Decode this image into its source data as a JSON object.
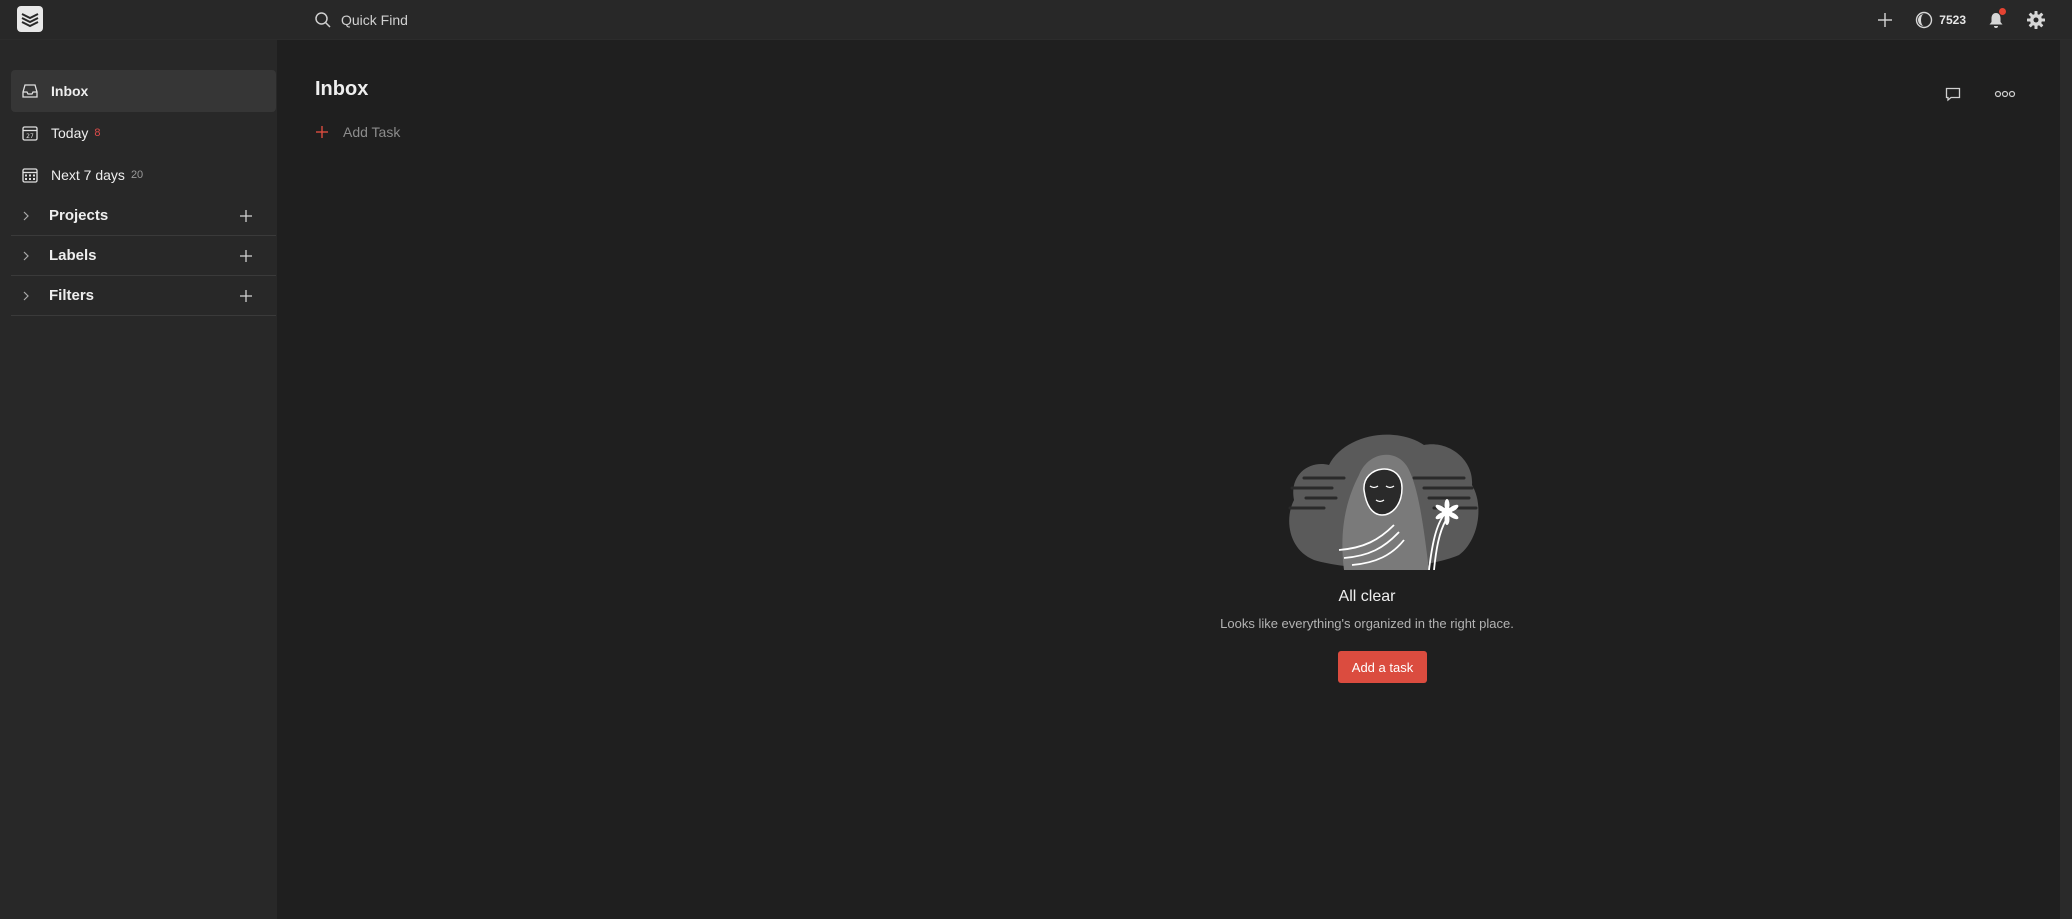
{
  "topbar": {
    "search_placeholder": "Quick Find",
    "karma_value": "7523"
  },
  "sidebar": {
    "items": [
      {
        "label": "Inbox",
        "count": ""
      },
      {
        "label": "Today",
        "count": "8"
      },
      {
        "label": "Next 7 days",
        "count": "20"
      }
    ],
    "sections": [
      {
        "label": "Projects"
      },
      {
        "label": "Labels"
      },
      {
        "label": "Filters"
      }
    ]
  },
  "main": {
    "title": "Inbox",
    "add_task_label": "Add Task"
  },
  "empty_state": {
    "title": "All clear",
    "subtitle": "Looks like everything's organized in the right place.",
    "button_label": "Add a task"
  },
  "colors": {
    "accent": "#db4c3f",
    "background": "#1f1f1f",
    "sidebar": "#282828"
  },
  "icons": [
    "todoist-logo-icon",
    "search-icon",
    "plus-icon",
    "karma-icon",
    "bell-icon",
    "gear-icon",
    "inbox-icon",
    "calendar-today-icon",
    "calendar-week-icon",
    "chevron-right-icon",
    "comment-icon",
    "more-icon"
  ]
}
